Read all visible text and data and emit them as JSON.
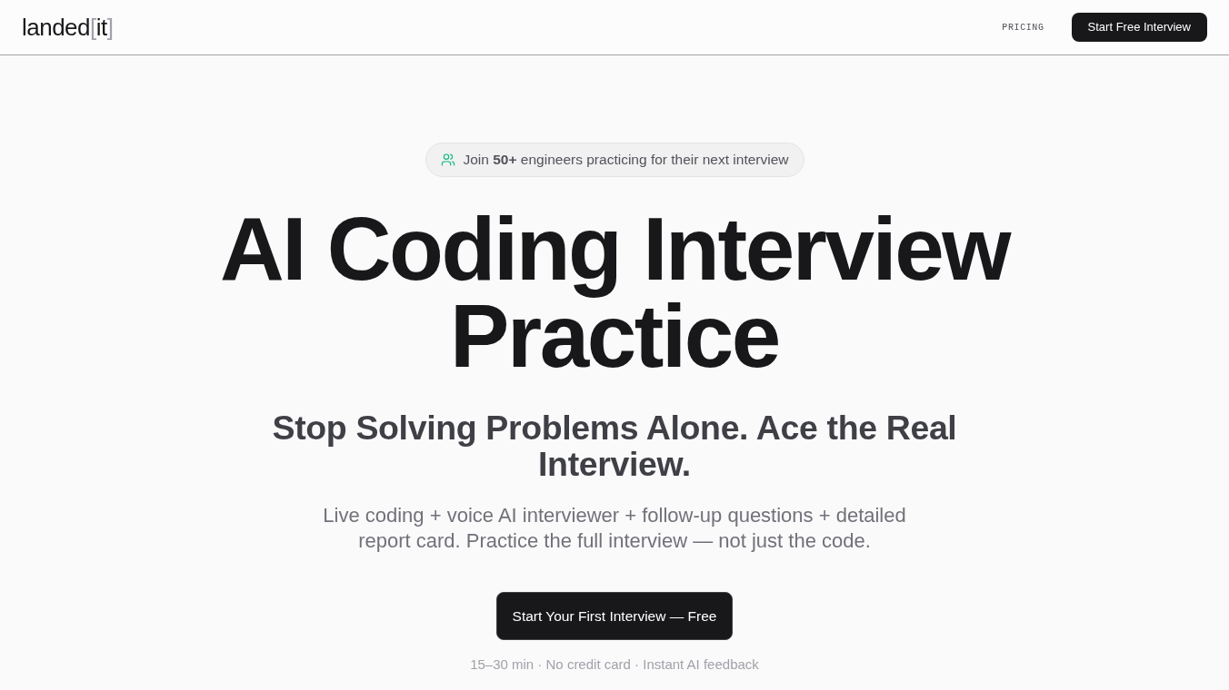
{
  "header": {
    "logo": [
      {
        "text": "landed",
        "muted": false
      },
      {
        "text": "[",
        "muted": true
      },
      {
        "text": "it",
        "muted": false
      },
      {
        "text": "]",
        "muted": true
      }
    ],
    "nav": [
      {
        "label": "PRICING",
        "kind": "link"
      },
      {
        "label": "Start Free Interview",
        "kind": "button"
      }
    ]
  },
  "hero": {
    "badge": "Join **50+** engineers practicing for their next interview",
    "title": "AI Coding Interview Practice",
    "subtitle": "Stop Solving Problems Alone. Ace the Real Interview.",
    "description": "Live coding + voice AI interviewer + follow-up questions + detailed report card. Practice the full interview — not just the code.",
    "cta": "Start Your First Interview — Free",
    "note": "15–30 min · No credit card · Instant AI feedback"
  }
}
